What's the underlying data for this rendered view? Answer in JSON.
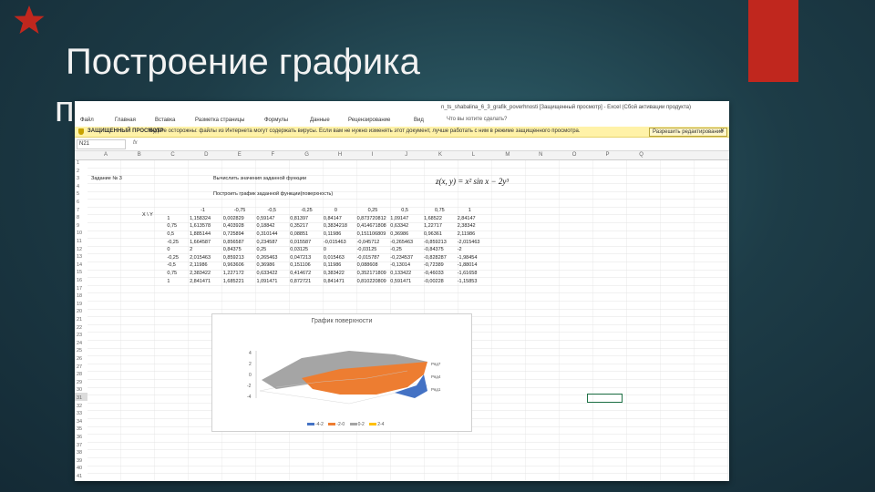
{
  "slide": {
    "title_line1": "Построение графика",
    "title_line2": "поверхности",
    "accent_color": "#c0271e",
    "icon": "star-icon"
  },
  "excel": {
    "window_title": "n_ts_shabalina_6_3_grafik_poverhnosti [Защищенный просмотр] - Excel (Сбой активации продукта)",
    "ribbon_tabs": [
      "Файл",
      "Главная",
      "Вставка",
      "Разметка страницы",
      "Формулы",
      "Данные",
      "Рецензирование",
      "Вид"
    ],
    "search_placeholder": "Что вы хотите сделать?",
    "protected_view": {
      "title": "ЗАЩИЩЕННЫЙ ПРОСМОТР",
      "message": "Будьте осторожны: файлы из Интернета могут содержать вирусы. Если вам не нужно изменять этот документ, лучше работать с ним в режиме защищенного просмотра.",
      "button": "Разрешить редактирование"
    },
    "name_box": "N21",
    "fx_label": "fx",
    "columns": [
      "A",
      "B",
      "C",
      "D",
      "E",
      "F",
      "G",
      "H",
      "I",
      "J",
      "K",
      "L",
      "M",
      "N",
      "O",
      "P",
      "Q"
    ],
    "task_label": "Задание № 3",
    "task_text": "Вычислить значения заданной функции",
    "build_text": "Построить график заданной функции(поверхность)",
    "formula": "z(x, y) = x² sin x − 2y³",
    "table": {
      "corner": "X \\ Y",
      "y_values": [
        "-1",
        "-0,75",
        "-0,5",
        "-0,25",
        "0",
        "0,25",
        "0,5",
        "0,75",
        "1"
      ],
      "rows": [
        {
          "x": "1",
          "values": [
            "1,158324",
            "0,002829",
            "0,59147",
            "0,81397",
            "0,84147",
            "0,873720812",
            "1,09147",
            "1,68522",
            "2,84147"
          ]
        },
        {
          "x": "0,75",
          "values": [
            "1,613578",
            "0,403928",
            "0,18842",
            "0,35217",
            "0,3834218",
            "0,414671808",
            "0,63342",
            "1,22717",
            "2,38342"
          ]
        },
        {
          "x": "0,5",
          "values": [
            "1,885144",
            "0,725894",
            "0,310144",
            "0,08851",
            "0,11986",
            "0,151106809",
            "0,36986",
            "0,96361",
            "2,11986"
          ]
        },
        {
          "x": "-0,25",
          "values": [
            "1,664587",
            "0,856587",
            "0,234587",
            "0,015587",
            "-0,015463",
            "-0,045712",
            "-0,265463",
            "-0,859213",
            "-2,015463"
          ]
        },
        {
          "x": "0",
          "values": [
            "2",
            "0,84375",
            "0,25",
            "0,03125",
            "0",
            "-0,03125",
            "-0,25",
            "-0,84375",
            "-2"
          ]
        },
        {
          "x": "-0,25",
          "values": [
            "2,015463",
            "0,859213",
            "0,265463",
            "0,047213",
            "0,015463",
            "-0,015787",
            "-0,234537",
            "-0,828287",
            "-1,98454"
          ]
        },
        {
          "x": "-0,5",
          "values": [
            "2,11986",
            "0,963606",
            "0,36986",
            "0,151106",
            "0,11986",
            "0,088608",
            "-0,13014",
            "-0,72389",
            "-1,88014"
          ]
        },
        {
          "x": "0,75",
          "values": [
            "2,383422",
            "1,227172",
            "0,633422",
            "0,414672",
            "0,383422",
            "0,352171809",
            "0,133422",
            "-0,46033",
            "-1,61658"
          ]
        },
        {
          "x": "1",
          "values": [
            "2,841471",
            "1,685221",
            "1,091471",
            "0,872721",
            "0,841471",
            "0,810220809",
            "0,591471",
            "-0,00228",
            "-1,15853"
          ]
        }
      ]
    },
    "chart": {
      "title": "График поверхности",
      "z_ticks": [
        "4",
        "2",
        "0",
        "-2",
        "-4"
      ],
      "side_labels": [
        "Ряд7",
        "Ряд4",
        "Ряд1"
      ],
      "legend": [
        "-4-2",
        "-2-0",
        "0-2",
        "2-4"
      ],
      "legend_colors": [
        "#4472c4",
        "#ed7d31",
        "#a5a5a5",
        "#ffc000"
      ]
    }
  }
}
